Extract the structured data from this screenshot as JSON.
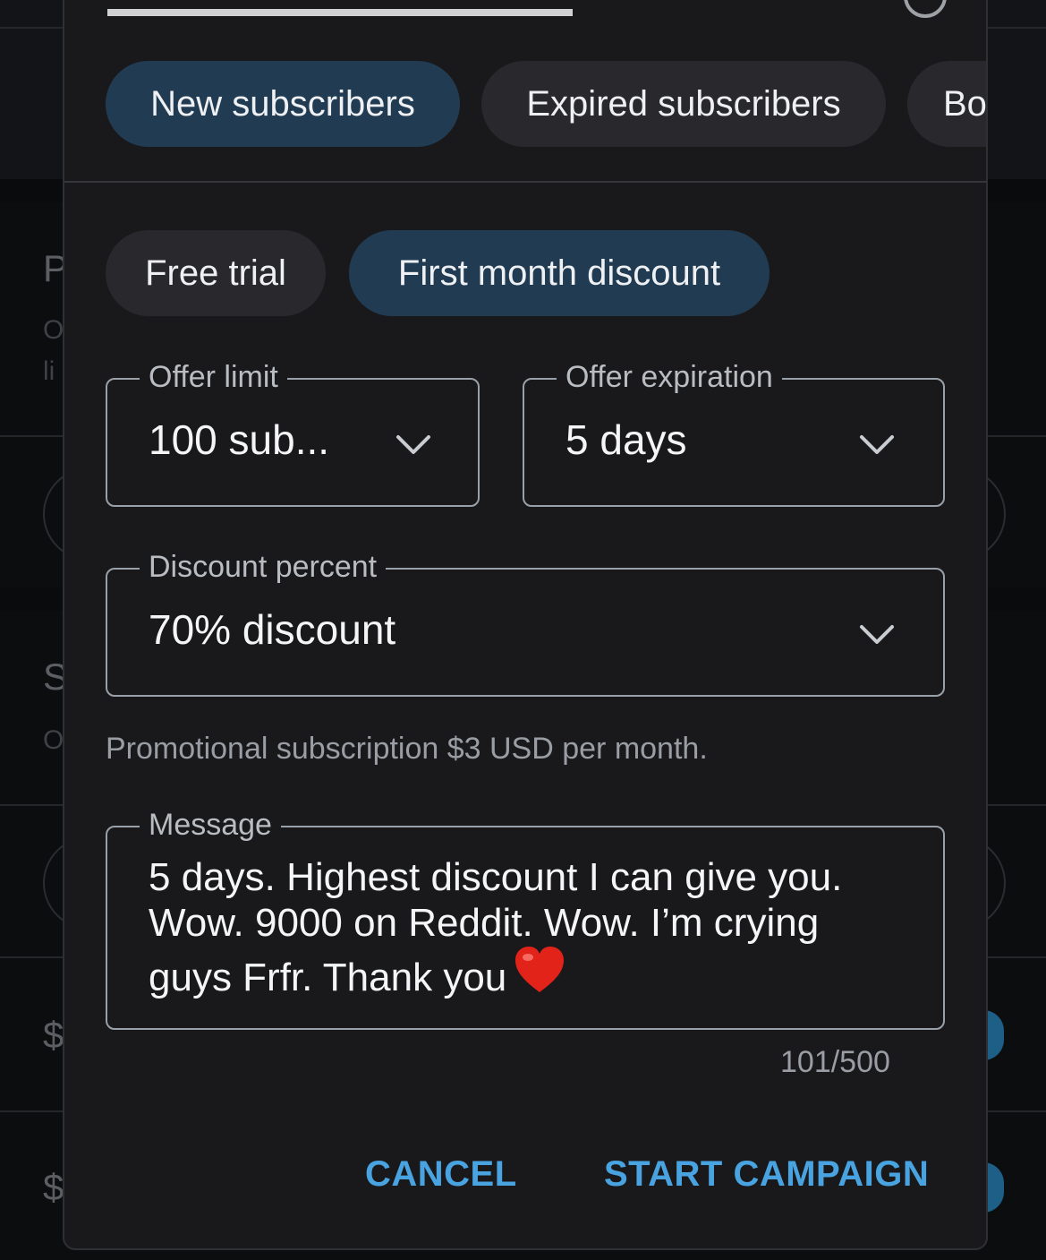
{
  "dialog": {
    "close_icon": "close-circle-icon"
  },
  "audience_tabs": [
    {
      "label": "New subscribers",
      "selected": true
    },
    {
      "label": "Expired subscribers",
      "selected": false
    },
    {
      "label": "Bo",
      "selected": false
    }
  ],
  "offer_type_tabs": [
    {
      "label": "Free trial",
      "selected": false
    },
    {
      "label": "First month discount",
      "selected": true
    }
  ],
  "offer_limit": {
    "label": "Offer limit",
    "value": "100 sub..."
  },
  "offer_expiration": {
    "label": "Offer expiration",
    "value": "5 days"
  },
  "discount_percent": {
    "label": "Discount percent",
    "value": "70% discount"
  },
  "helper_text": "Promotional subscription $3 USD per month.",
  "message": {
    "label": "Message",
    "lines": [
      "5 days. Highest discount I can give you.",
      "Wow. 9000 on Reddit. Wow. I’m crying",
      "guys Frfr. Thank you"
    ],
    "emoji_icon": "red-heart-icon",
    "counter": "101/500"
  },
  "actions": {
    "cancel": "CANCEL",
    "start": "START CAMPAIGN"
  },
  "background": {
    "letters": [
      "P",
      "O",
      "li",
      "S",
      "O",
      "$",
      "$"
    ]
  },
  "colors": {
    "accent": "#49a3e0",
    "chip_active": "#213c52",
    "chip": "#29292d",
    "dialog": "#19191c"
  }
}
